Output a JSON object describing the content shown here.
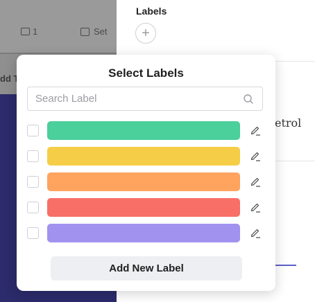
{
  "background": {
    "comment_count": "1",
    "set_date_label": "Set",
    "add_text": "dd Ta"
  },
  "right_panel": {
    "labels_heading": "Labels",
    "add_label_symbol": "+",
    "partial_text": "etrol",
    "progress_fraction": 0.11
  },
  "popup": {
    "title": "Select Labels",
    "search": {
      "placeholder": "Search Label",
      "value": "",
      "icon": "search-icon"
    },
    "labels": [
      {
        "color": "#4bcf9b",
        "checked": false,
        "edit_icon": "pencil-icon"
      },
      {
        "color": "#f6cd47",
        "checked": false,
        "edit_icon": "pencil-icon"
      },
      {
        "color": "#fea45f",
        "checked": false,
        "edit_icon": "pencil-icon"
      },
      {
        "color": "#f86f68",
        "checked": false,
        "edit_icon": "pencil-icon"
      },
      {
        "color": "#a292ef",
        "checked": false,
        "edit_icon": "pencil-icon"
      }
    ],
    "add_button_label": "Add New Label"
  },
  "colors": {
    "overlay_gray": "#8f8f8f",
    "navy": "#2c2b6b",
    "accent": "#5b5fc7"
  }
}
